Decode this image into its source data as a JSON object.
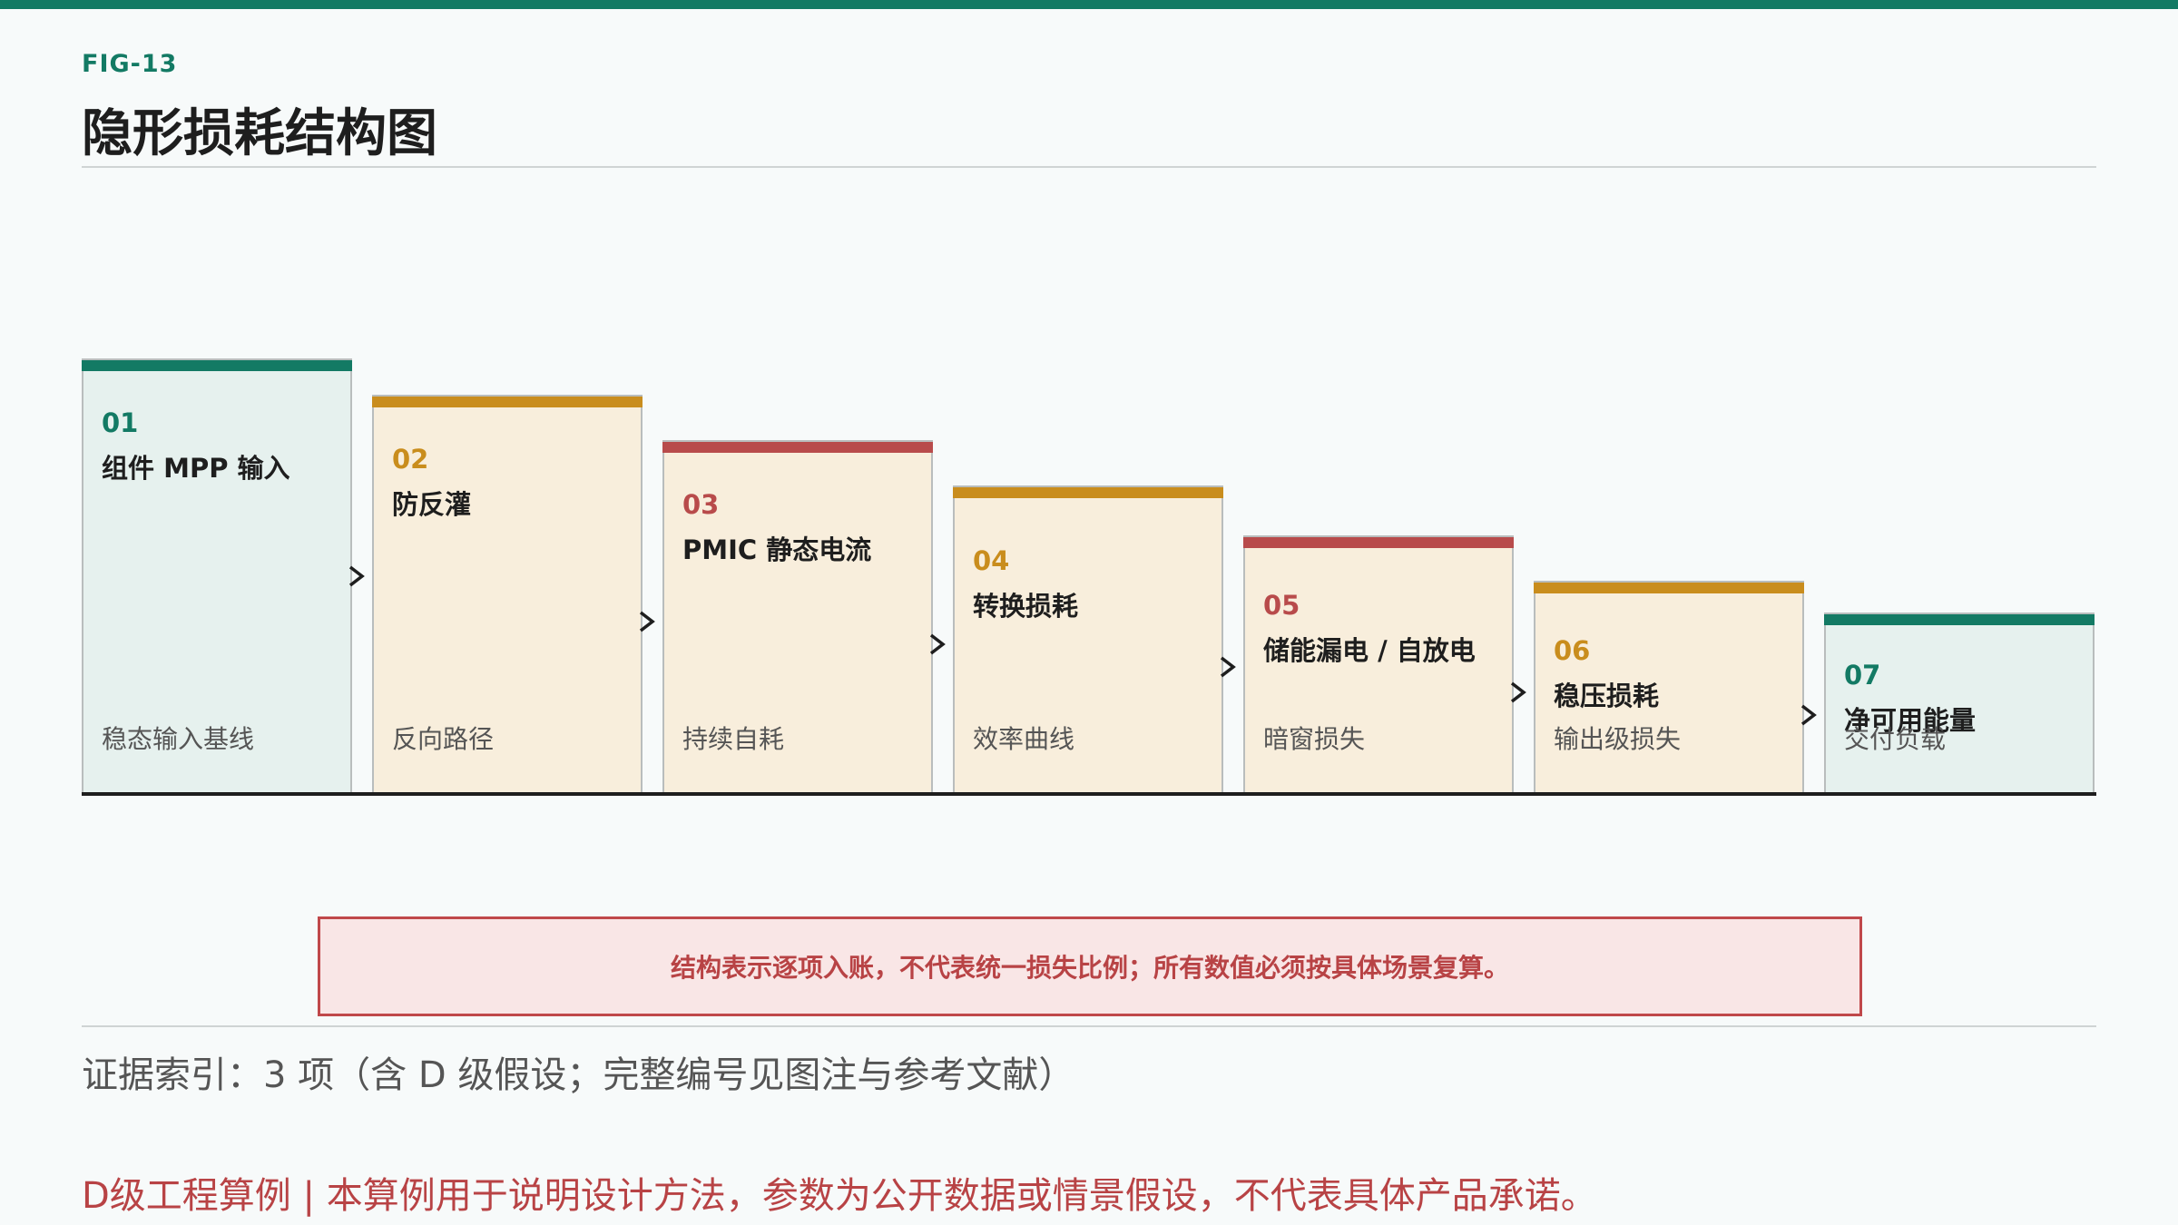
{
  "header": {
    "fig_label": "FIG-13",
    "title": "隐形损耗结构图"
  },
  "steps": [
    {
      "num": "01",
      "title": "组件 MPP 输入",
      "sub": "稳态输入基线",
      "tier": "base"
    },
    {
      "num": "02",
      "title": "防反灌",
      "sub": "反向路径",
      "tier": "loss"
    },
    {
      "num": "03",
      "title": "PMIC 静态电流",
      "sub": "持续自耗",
      "tier": "critical"
    },
    {
      "num": "04",
      "title": "转换损耗",
      "sub": "效率曲线",
      "tier": "loss"
    },
    {
      "num": "05",
      "title": "储能漏电 / 自放电",
      "sub": "暗窗损失",
      "tier": "critical"
    },
    {
      "num": "06",
      "title": "稳压损耗",
      "sub": "输出级损失",
      "tier": "loss"
    },
    {
      "num": "07",
      "title": "净可用能量",
      "sub": "交付负载",
      "tier": "base"
    }
  ],
  "colors": {
    "base": {
      "bar": "#137a64",
      "fill": "#e6f1ee",
      "text": "#137a64"
    },
    "loss": {
      "bar": "#c98d1d",
      "fill": "#f8eedc",
      "text": "#c98d1d"
    },
    "critical": {
      "bar": "#b84b4b",
      "fill": "#f8eedc",
      "text": "#b84b4b"
    }
  },
  "note": "结构表示逐项入账，不代表统一损失比例；所有数值必须按具体场景复算。",
  "evidence": "证据索引：3 项（含 D 级假设；完整编号见图注与参考文献）",
  "disclaimer": "D级工程算例 | 本算例用于说明设计方法，参数为公开数据或情景假设，不代表具体产品承诺。"
}
